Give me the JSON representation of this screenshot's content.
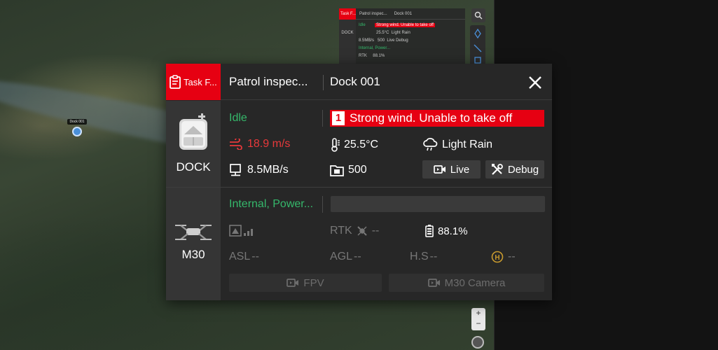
{
  "map": {
    "dock_marker_label": "Dock 001",
    "zoom_in": "+",
    "zoom_out": "−"
  },
  "mini_panel": {
    "task": "Task F...",
    "title": "Patrol inspec...",
    "dock": "Dock 001",
    "side": "DOCK",
    "status": "Idle",
    "alert": "Strong wind. Unable to take off",
    "temp": "25.5°C",
    "weather": "Light Rain",
    "net": "8.5MB/s",
    "storage": "500",
    "live": "Live",
    "debug": "Debug",
    "internal": "Internal, Power...",
    "rtk": "RTK",
    "battery": "88.1%"
  },
  "header": {
    "task_label": "Task F...",
    "task_title": "Patrol inspec...",
    "dock_name": "Dock 001"
  },
  "dock": {
    "side_label": "DOCK",
    "status": "Idle",
    "alert_count": "1",
    "alert_text": "Strong wind. Unable to take off",
    "wind_speed": "18.9 m/s",
    "temperature": "25.5°C",
    "weather": "Light Rain",
    "network": "8.5MB/s",
    "storage": "500",
    "live_label": "Live",
    "debug_label": "Debug"
  },
  "drone": {
    "side_label": "M30",
    "status": "Internal, Power...",
    "rtk_label": "RTK",
    "rtk_value": "--",
    "battery": "88.1%",
    "asl_label": "ASL",
    "asl_value": "--",
    "agl_label": "AGL",
    "agl_value": "--",
    "hs_label": "H.S",
    "hs_value": "--",
    "home_value": "--",
    "fpv_label": "FPV",
    "camera_label": "M30 Camera"
  },
  "colors": {
    "accent_red": "#e60012",
    "status_green": "#35b86b",
    "panel_bg": "#272727",
    "side_bg": "#353535"
  }
}
